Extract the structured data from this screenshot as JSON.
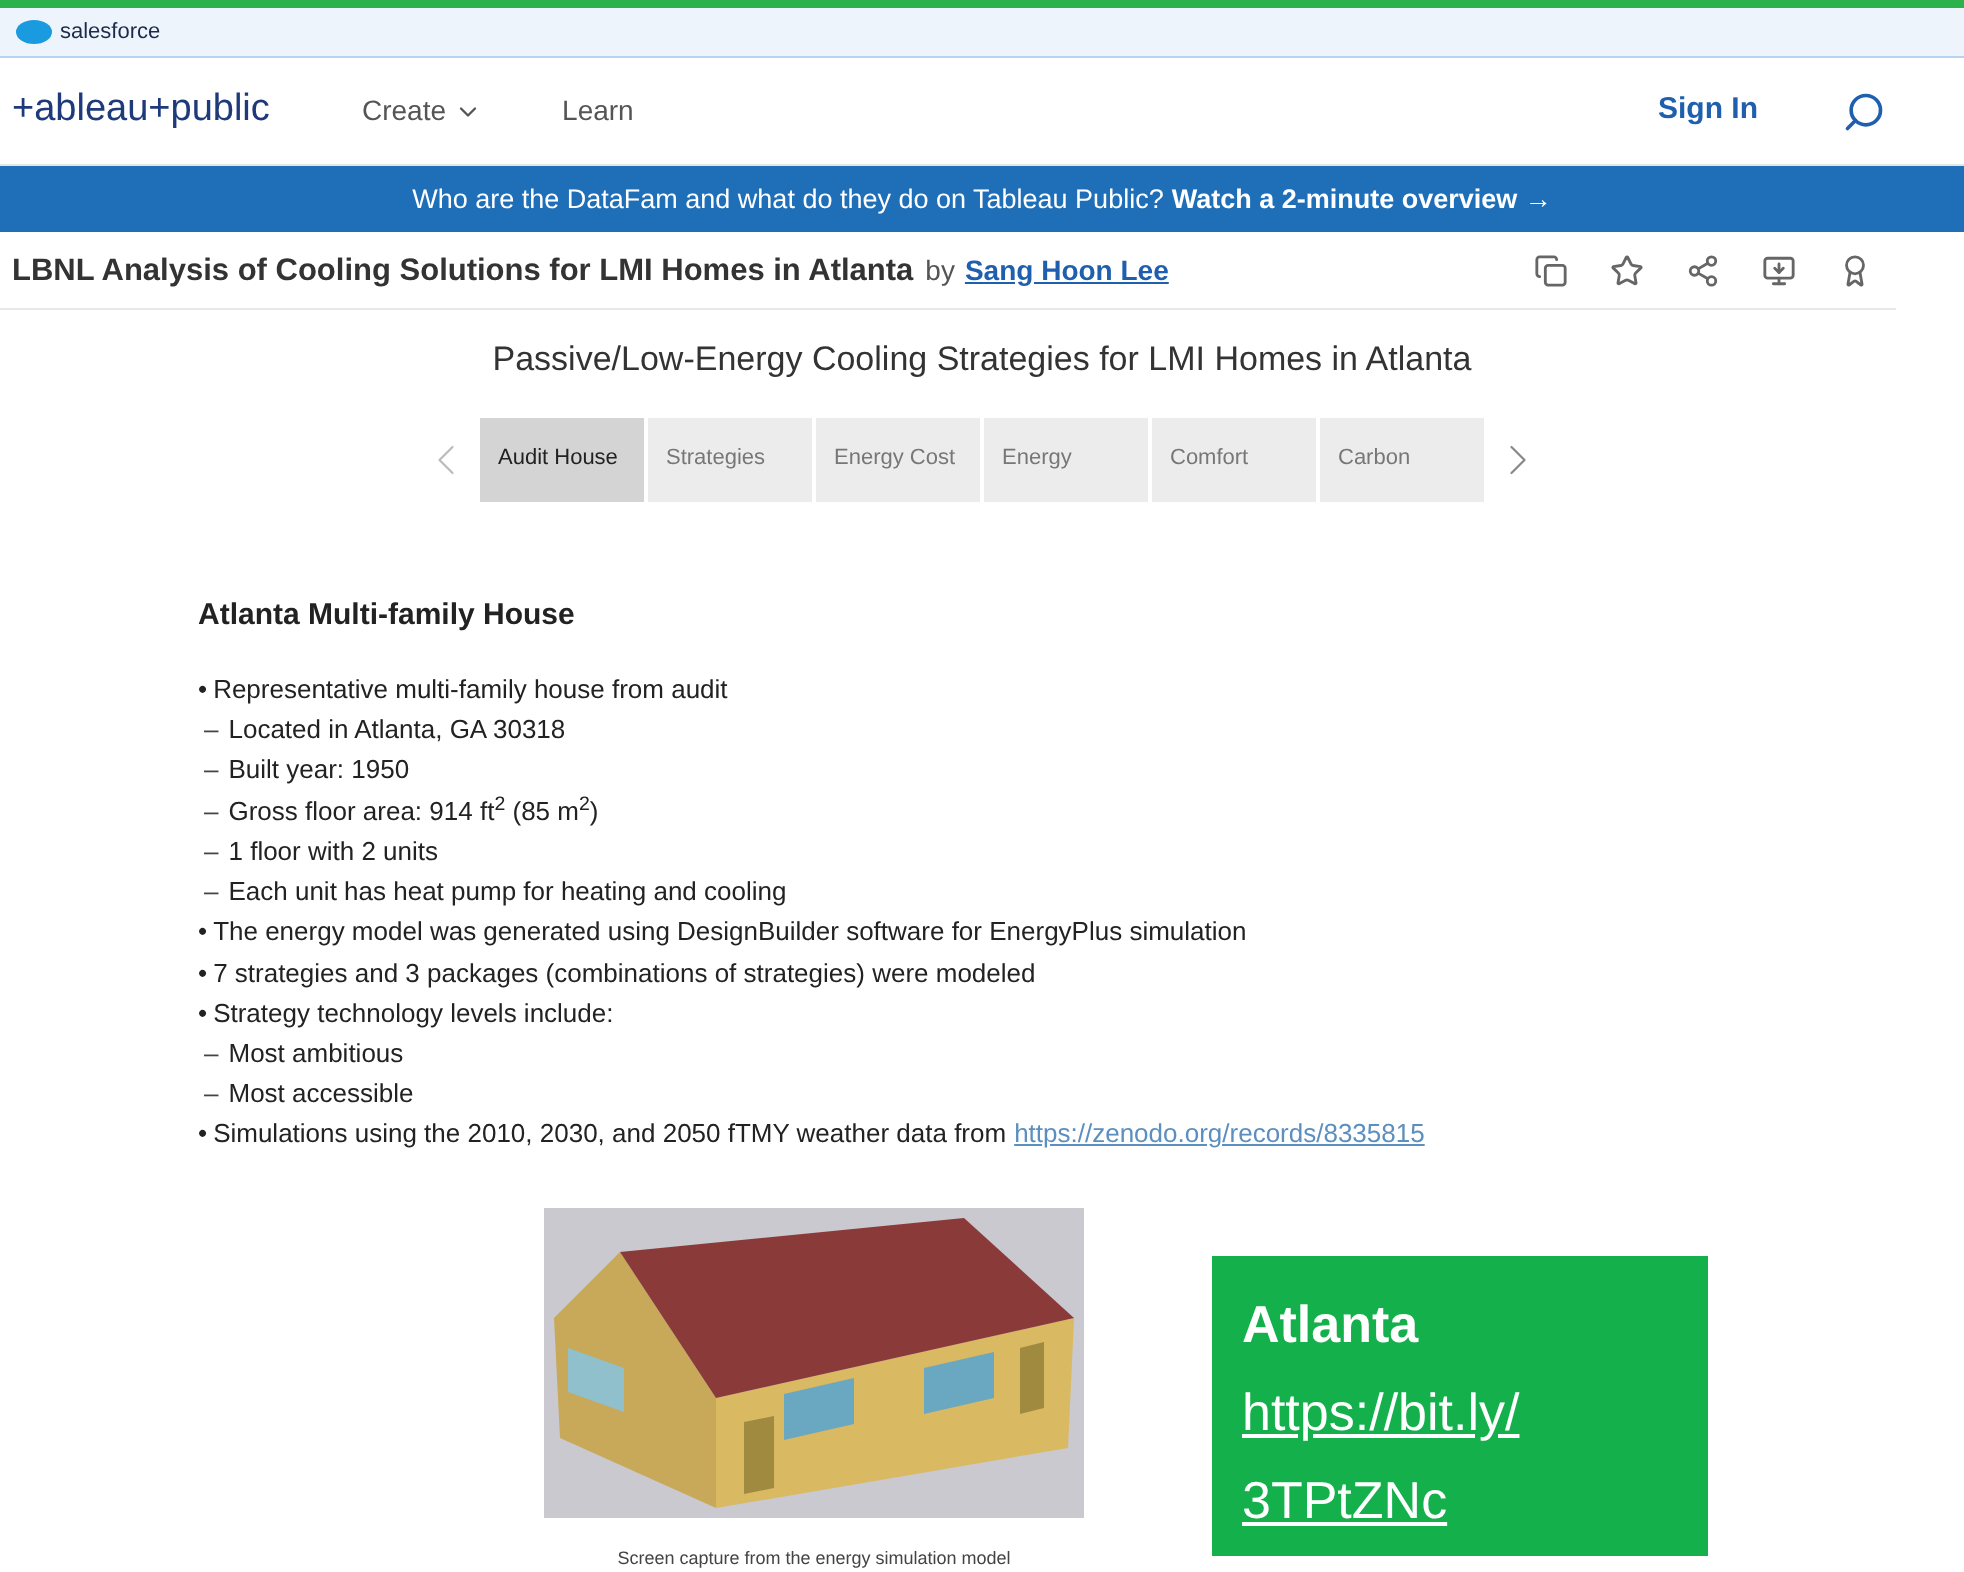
{
  "top_bar": {
    "brand": "salesforce"
  },
  "nav": {
    "logo": "+ableau+public",
    "items": [
      {
        "label": "Create",
        "dropdown": true
      },
      {
        "label": "Learn",
        "dropdown": false
      }
    ],
    "sign_in": "Sign In"
  },
  "banner": {
    "text": "Who are the DataFam and what do they do on Tableau Public?",
    "link": "Watch a 2-minute overview →"
  },
  "viz_header": {
    "title": "LBNL Analysis of Cooling Solutions for LMI Homes in Atlanta",
    "by": "by",
    "author": "Sang Hoon Lee"
  },
  "dashboard": {
    "title": "Passive/Low-Energy Cooling Strategies for LMI Homes in Atlanta",
    "tabs": [
      {
        "label": "Audit House",
        "selected": true
      },
      {
        "label": "Strategies",
        "selected": false
      },
      {
        "label": "Energy Cost",
        "selected": false
      },
      {
        "label": "Energy",
        "selected": false
      },
      {
        "label": "Comfort",
        "selected": false
      },
      {
        "label": "Carbon",
        "selected": false
      }
    ],
    "heading": "Atlanta Multi-family House",
    "lines": [
      {
        "kind": "bullet",
        "marker": "•",
        "text": "Representative multi-family house from audit"
      },
      {
        "kind": "dash",
        "marker": "–",
        "text": "Located in Atlanta, GA 30318"
      },
      {
        "kind": "dash",
        "marker": "–",
        "text": "Built year: 1950"
      },
      {
        "kind": "dash",
        "marker": "–",
        "text": "Gross floor area: 914 ft$^{2}$ (85 m$^{2}$)"
      },
      {
        "kind": "dash",
        "marker": "–",
        "text": "1 floor with 2 units"
      },
      {
        "kind": "dash",
        "marker": "–",
        "text": "Each unit has heat pump for heating and cooling"
      },
      {
        "kind": "bullet",
        "marker": "•",
        "text": "The energy model was generated using DesignBuilder software for EnergyPlus simulation"
      },
      {
        "kind": "bullet",
        "marker": "•",
        "text": "7 strategies and 3 packages (combinations of strategies) were modeled"
      },
      {
        "kind": "bullet",
        "marker": "•",
        "text": "Strategy technology levels include:"
      },
      {
        "kind": "dash",
        "marker": "–",
        "text": "Most ambitious"
      },
      {
        "kind": "dash",
        "marker": "–",
        "text": "Most accessible"
      },
      {
        "kind": "bullet",
        "marker": "•",
        "text": "Simulations using the 2010, 2030, and 2050 fTMY weather data from",
        "link": "https://zenodo.org/records/8335815"
      }
    ],
    "image": {
      "kind": "picture",
      "caption": "Screen capture from the energy simulation model"
    },
    "callout": {
      "title": "Atlanta",
      "link_lines": [
        "https://bit.ly/",
        "3TPtZNc"
      ]
    }
  }
}
